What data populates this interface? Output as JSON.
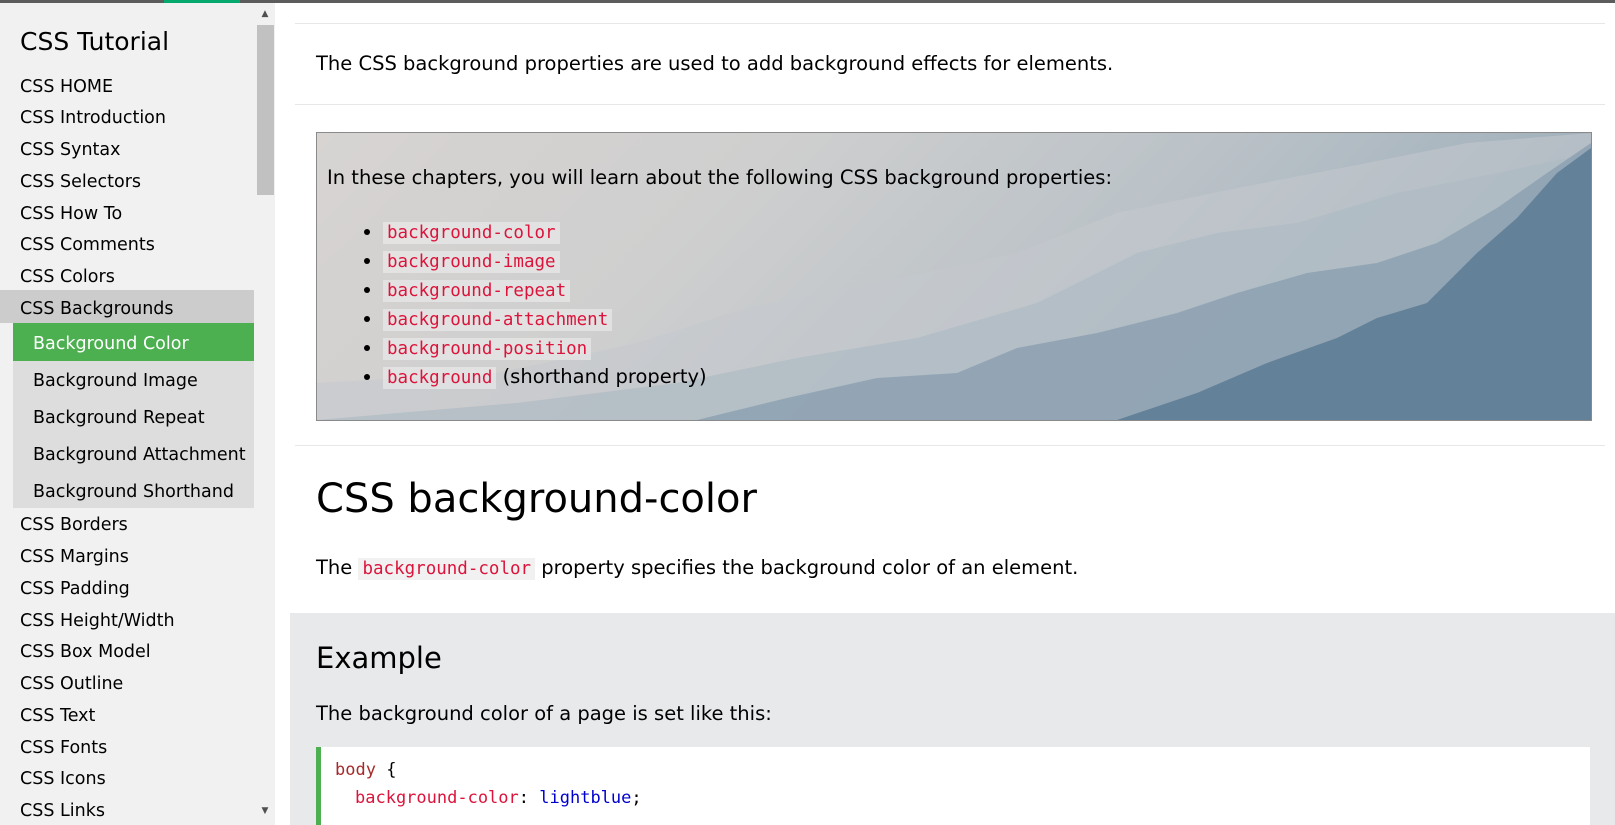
{
  "sidebar": {
    "title": "CSS Tutorial",
    "links_top": [
      "CSS HOME",
      "CSS Introduction",
      "CSS Syntax",
      "CSS Selectors",
      "CSS How To",
      "CSS Comments",
      "CSS Colors"
    ],
    "active_group": "CSS Backgrounds",
    "sub_items": [
      "Background Color",
      "Background Image",
      "Background Repeat",
      "Background Attachment",
      "Background Shorthand"
    ],
    "links_bottom": [
      "CSS Borders",
      "CSS Margins",
      "CSS Padding",
      "CSS Height/Width",
      "CSS Box Model",
      "CSS Outline",
      "CSS Text",
      "CSS Fonts",
      "CSS Icons",
      "CSS Links"
    ]
  },
  "main": {
    "intro": "The CSS background properties are used to add background effects for elements.",
    "hero": {
      "intro": "In these chapters, you will learn about the following CSS background properties:",
      "properties": [
        "background-color",
        "background-image",
        "background-repeat",
        "background-attachment",
        "background-position",
        "background"
      ],
      "last_suffix": "(shorthand property)"
    },
    "heading": "CSS background-color",
    "desc": {
      "prefix": "The",
      "code": "background-color",
      "suffix": "property specifies the background color of an element."
    },
    "example": {
      "title": "Example",
      "desc": "The background color of a page is set like this:",
      "code_selector": "body",
      "code_open": "{",
      "code_prop": "background-color",
      "code_colon": ":",
      "code_value": "lightblue",
      "code_semicolon": ";"
    }
  },
  "colors": {
    "accent_green": "#4caf50",
    "code_red": "#dc143c",
    "sidebar_bg": "#f1f1f1"
  }
}
